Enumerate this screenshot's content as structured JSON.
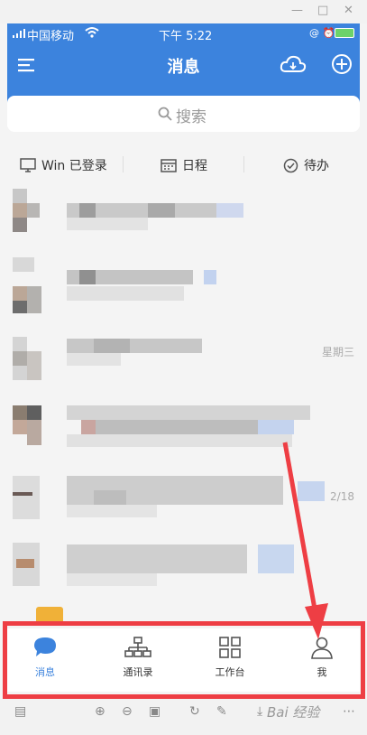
{
  "status": {
    "carrier": "中国移动",
    "time": "下午 5:22",
    "indicators": "@ ⏰"
  },
  "header": {
    "title": "消息",
    "icons": [
      "menu-icon",
      "cloud-icon",
      "plus-circle-icon"
    ]
  },
  "search": {
    "placeholder": "搜索"
  },
  "quick_actions": [
    {
      "label": "Win 已登录",
      "icon": "monitor-icon"
    },
    {
      "label": "日程",
      "icon": "calendar-icon"
    },
    {
      "label": "待办",
      "icon": "check-circle-icon"
    }
  ],
  "messages": [
    {
      "time": ""
    },
    {
      "time": ""
    },
    {
      "time": "星期三"
    },
    {
      "time": ""
    },
    {
      "time": "2/18"
    },
    {
      "time": ""
    }
  ],
  "tabs": [
    {
      "label": "消息",
      "icon": "chat-bubble-icon",
      "active": true
    },
    {
      "label": "通讯录",
      "icon": "org-chart-icon",
      "active": false
    },
    {
      "label": "工作台",
      "icon": "grid-icon",
      "active": false
    },
    {
      "label": "我",
      "icon": "person-icon",
      "active": false
    }
  ],
  "colors": {
    "brand": "#3c83dd",
    "annotation": "#ee3e44",
    "badge": "#f0b138"
  },
  "watermark": "Bai 经验"
}
